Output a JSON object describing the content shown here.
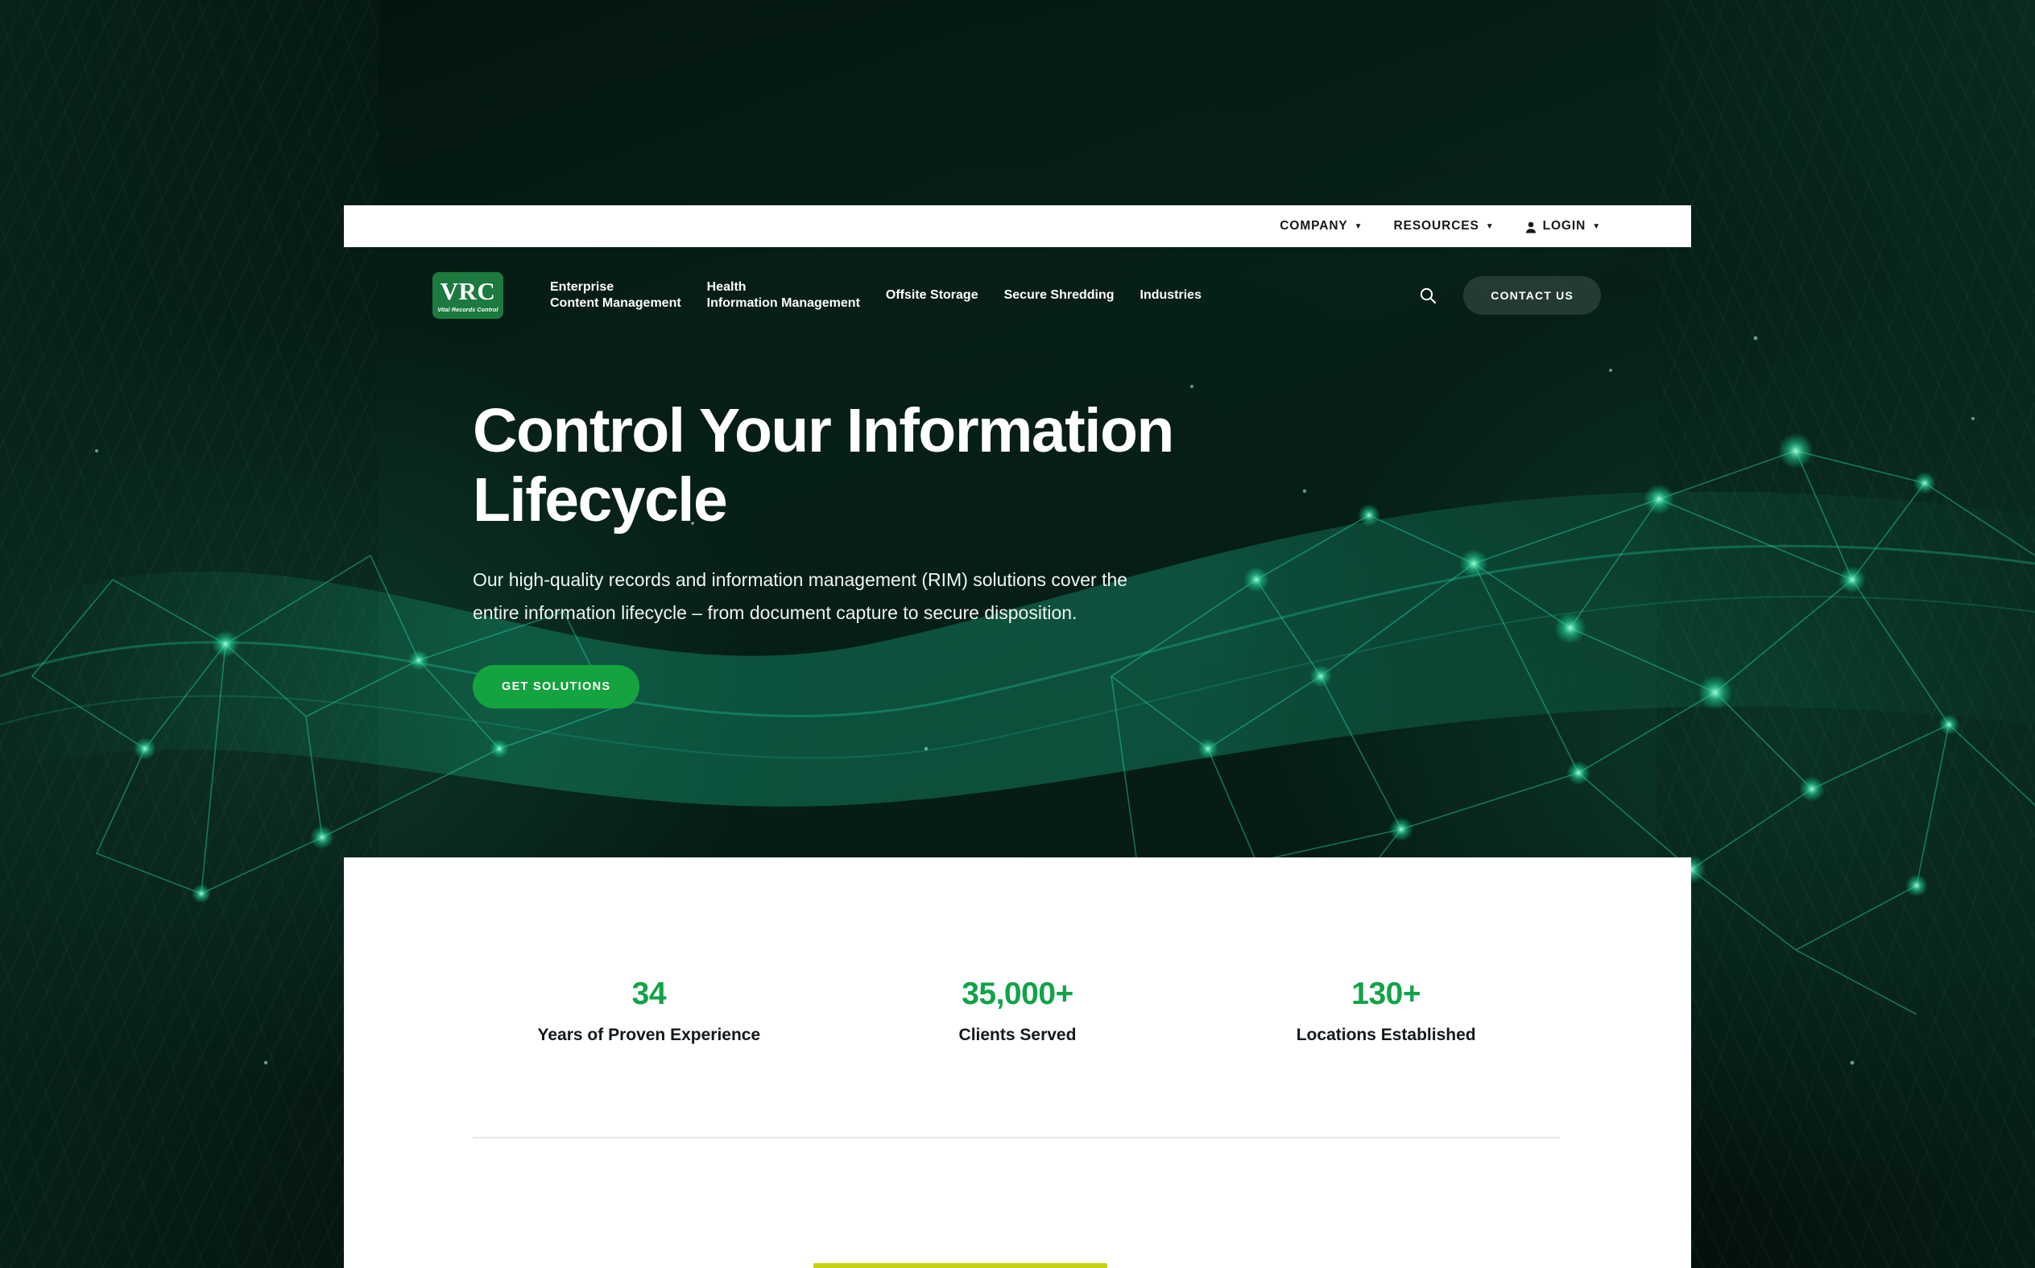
{
  "brand": {
    "logo_mark": "VRC",
    "logo_sub": "Vital Records Control",
    "accent_green": "#14a33f",
    "stat_green": "#12a349",
    "accent_yellow": "#c5d210",
    "hero_bg": "#05180f"
  },
  "utility_bar": {
    "items": [
      {
        "label": "COMPANY",
        "caret": "▼",
        "icon": ""
      },
      {
        "label": "RESOURCES",
        "caret": "▼",
        "icon": ""
      },
      {
        "label": "LOGIN",
        "caret": "▼",
        "icon": "person-icon"
      }
    ]
  },
  "main_nav": {
    "links": [
      {
        "line1": "Enterprise",
        "line2": "Content Management"
      },
      {
        "line1": "Health",
        "line2": "Information Management"
      },
      {
        "line1": "Offsite Storage",
        "line2": ""
      },
      {
        "line1": "Secure Shredding",
        "line2": ""
      },
      {
        "line1": "Industries",
        "line2": ""
      }
    ],
    "search_icon": "search-icon",
    "contact_label": "CONTACT US"
  },
  "hero": {
    "title": "Control Your Information Lifecycle",
    "subtitle": "Our high-quality records and information management (RIM) solutions cover the entire information lifecycle – from document capture to secure disposition.",
    "cta_label": "GET SOLUTIONS"
  },
  "stats": [
    {
      "value": "34",
      "label": "Years of Proven Experience"
    },
    {
      "value": "35,000+",
      "label": "Clients Served"
    },
    {
      "value": "130+",
      "label": "Locations Established"
    }
  ]
}
